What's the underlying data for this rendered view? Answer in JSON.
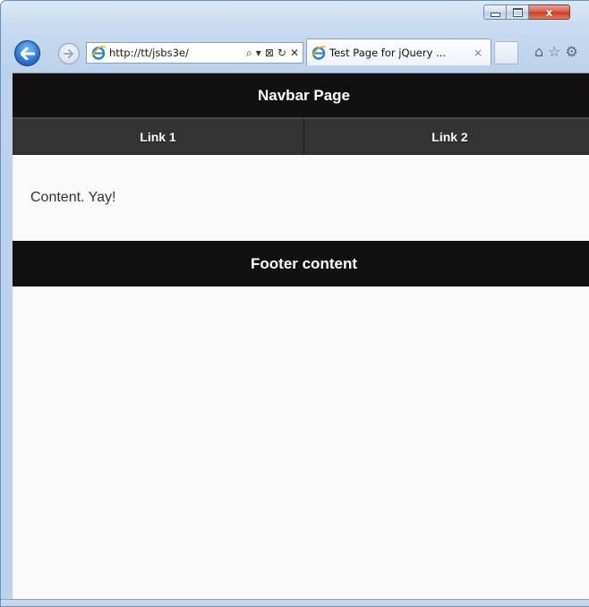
{
  "browser": {
    "address_url": "http://tt/jsbs3e/",
    "address_tools": [
      "⌕",
      "▾",
      "⊠",
      "↻",
      "✕"
    ],
    "tab_title": "Test Page for jQuery ...",
    "tab_close": "×",
    "command_icons": [
      "⌂",
      "☆",
      "⚙"
    ],
    "caption": {
      "min": "",
      "max": "",
      "close": "x"
    }
  },
  "page": {
    "header_title": "Navbar Page",
    "nav_links": [
      "Link 1",
      "Link 2"
    ],
    "content_text": "Content. Yay!",
    "footer_text": "Footer content"
  },
  "colors": {
    "header_bg": "#111111",
    "navbar_bg": "#333333",
    "page_bg": "#f9f9f9"
  }
}
